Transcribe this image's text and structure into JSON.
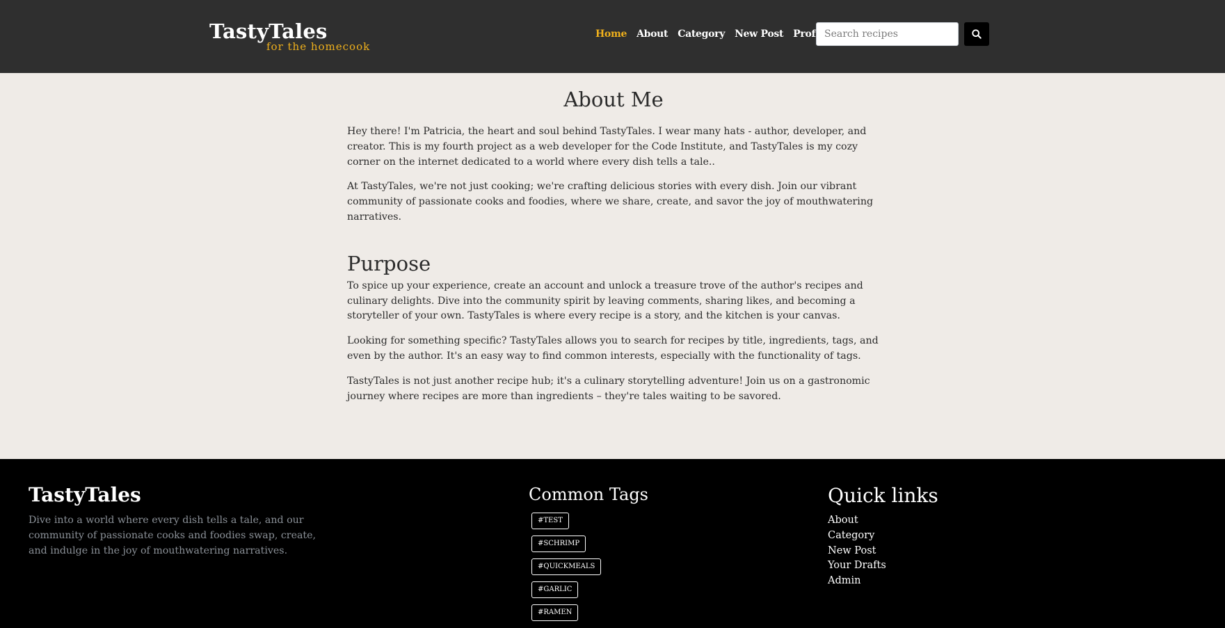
{
  "header": {
    "brand": "TastyTales",
    "tagline": "for the homecook",
    "nav": [
      {
        "label": "Home",
        "active": true
      },
      {
        "label": "About",
        "active": false
      },
      {
        "label": "Category",
        "active": false
      },
      {
        "label": "New Post",
        "active": false
      },
      {
        "label": "Profile",
        "active": false
      }
    ],
    "search": {
      "placeholder": "Search recipes",
      "value": ""
    },
    "search_button_icon": "search-icon",
    "accent_color": "#f0b11c"
  },
  "main": {
    "title": "About Me",
    "paragraphs_intro": [
      "Hey there! I'm Patricia, the heart and soul behind TastyTales. I wear many hats - author, developer, and creator. This is my fourth project as a web developer for the Code Institute, and TastyTales is my cozy corner on the internet dedicated to a world where every dish tells a tale..",
      "At TastyTales, we're not just cooking; we're crafting delicious stories with every dish. Join our vibrant community of passionate cooks and foodies, where we share, create, and savor the joy of mouthwatering narratives."
    ],
    "section_title": "Purpose",
    "paragraphs_purpose": [
      "To spice up your experience, create an account and unlock a treasure trove of the author's recipes and culinary delights. Dive into the community spirit by leaving comments, sharing likes, and becoming a storyteller of your own. TastyTales is where every recipe is a story, and the kitchen is your canvas.",
      "Looking for something specific? TastyTales allows you to search for recipes by title, ingredients, tags, and even by the author. It's an easy way to find common interests, especially with the functionality of tags.",
      "TastyTales is not just another recipe hub; it's a culinary storytelling adventure! Join us on a gastronomic journey where recipes are more than ingredients – they're tales waiting to be savored."
    ]
  },
  "footer": {
    "brand": "TastyTales",
    "description": "Dive into a world where every dish tells a tale, and our community of passionate cooks and foodies swap, create, and indulge in the joy of mouthwatering narratives.",
    "tags_title": "Common Tags",
    "tags": [
      "#TEST",
      "#SCHRIMP",
      "#QUICKMEALS",
      "#GARLIC",
      "#RAMEN"
    ],
    "links_title": "Quick links",
    "links": [
      "About",
      "Category",
      "New Post",
      "Your Drafts",
      "Admin"
    ]
  }
}
